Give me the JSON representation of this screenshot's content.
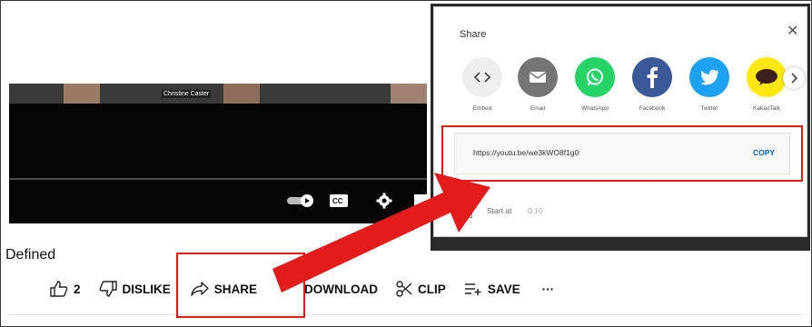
{
  "video": {
    "caption_name": "Christine Caster"
  },
  "page": {
    "title": "Defined"
  },
  "actions": {
    "like_count": "2",
    "dislike_label": "DISLIKE",
    "share_label": "SHARE",
    "download_label": "DOWNLOAD",
    "clip_label": "CLIP",
    "save_label": "SAVE",
    "more_label": "···"
  },
  "share_dialog": {
    "title": "Share",
    "close_glyph": "✕",
    "targets": [
      {
        "label": "Embed",
        "icon": "embed-icon",
        "color": "#eeeeee"
      },
      {
        "label": "Email",
        "icon": "email-icon",
        "color": "#757575"
      },
      {
        "label": "WhatsApp",
        "icon": "whatsapp-icon",
        "color": "#25d366"
      },
      {
        "label": "Facebook",
        "icon": "facebook-icon",
        "color": "#3b5998"
      },
      {
        "label": "Twitter",
        "icon": "twitter-icon",
        "color": "#1da1f2"
      },
      {
        "label": "KakaoTalk",
        "icon": "kakaotalk-icon",
        "color": "#ffe812"
      }
    ],
    "url": "https://youtu.be/we3kWO8f1g0",
    "copy_label": "COPY",
    "start_at_label": "Start at",
    "start_at_value": "0:10"
  },
  "annotation_color": "#e41b1b"
}
